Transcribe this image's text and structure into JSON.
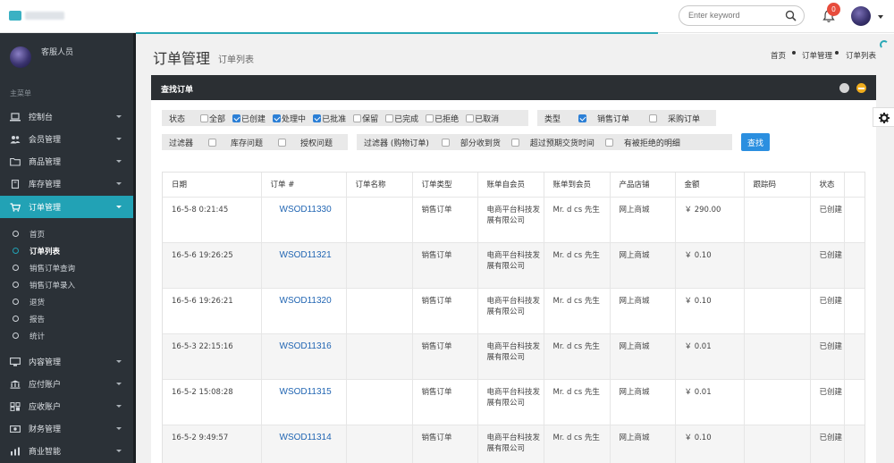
{
  "header": {
    "search_placeholder": "Enter keyword",
    "notification_count": "0"
  },
  "sidebar": {
    "user_name": "客服人员",
    "menu_heading": "主菜单",
    "items": [
      {
        "label": "控制台",
        "icon": "laptop-icon"
      },
      {
        "label": "会员管理",
        "icon": "users-icon"
      },
      {
        "label": "商品管理",
        "icon": "folder-icon"
      },
      {
        "label": "库存管理",
        "icon": "book-icon"
      },
      {
        "label": "订单管理",
        "icon": "cart-icon",
        "active": true
      }
    ],
    "sub_items": [
      {
        "label": "首页"
      },
      {
        "label": "订单列表",
        "current": true
      },
      {
        "label": "销售订单查询"
      },
      {
        "label": "销售订单录入"
      },
      {
        "label": "退货"
      },
      {
        "label": "报告"
      },
      {
        "label": "统计"
      }
    ],
    "items_after": [
      {
        "label": "内容管理",
        "icon": "desktop-icon"
      },
      {
        "label": "应付账户",
        "icon": "bank-icon"
      },
      {
        "label": "应收账户",
        "icon": "receivable-icon"
      },
      {
        "label": "财务管理",
        "icon": "money-icon"
      },
      {
        "label": "商业智能",
        "icon": "chart-icon"
      }
    ]
  },
  "page": {
    "title": "订单管理",
    "subtitle": "订单列表",
    "breadcrumb": [
      "首页",
      "订单管理",
      "订单列表"
    ]
  },
  "panel": {
    "title": "查找订单"
  },
  "filters": {
    "status_label": "状态",
    "status_options": [
      {
        "label": "全部",
        "checked": false
      },
      {
        "label": "已创建",
        "checked": true
      },
      {
        "label": "处理中",
        "checked": true
      },
      {
        "label": "已批准",
        "checked": true
      },
      {
        "label": "保留",
        "checked": false
      },
      {
        "label": "已完成",
        "checked": false
      },
      {
        "label": "已拒绝",
        "checked": false
      },
      {
        "label": "已取消",
        "checked": false
      }
    ],
    "type_label": "类型",
    "type_options": [
      {
        "label": "销售订单",
        "checked": true
      },
      {
        "label": "采购订单",
        "checked": false
      }
    ],
    "filter_label": "过滤器",
    "filter_options": [
      {
        "label": "库存问题",
        "checked": false
      },
      {
        "label": "授权问题",
        "checked": false
      }
    ],
    "cart_filter_label": "过滤器 (购物订单)",
    "cart_filter_options": [
      {
        "label": "部分收到货",
        "checked": false
      },
      {
        "label": "超过预期交货时间",
        "checked": false
      },
      {
        "label": "有被拒绝的明细",
        "checked": false
      }
    ],
    "search_button": "查找"
  },
  "table": {
    "columns": [
      "日期",
      "订单 #",
      "订单名称",
      "订单类型",
      "账单自会员",
      "账单到会员",
      "产品店铺",
      "金额",
      "跟踪码",
      "状态"
    ],
    "rows": [
      {
        "date": "16-5-8 0:21:45",
        "order": "WSOD11330",
        "name": "",
        "type": "销售订单",
        "from": "电商平台科技发展有限公司",
        "to": "Mr. d cs 先生",
        "store": "网上商城",
        "amount": "￥ 290.00",
        "tracking": "",
        "status": "已创建"
      },
      {
        "date": "16-5-6 19:26:25",
        "order": "WSOD11321",
        "name": "",
        "type": "销售订单",
        "from": "电商平台科技发展有限公司",
        "to": "Mr. d cs 先生",
        "store": "网上商城",
        "amount": "￥ 0.10",
        "tracking": "",
        "status": "已创建"
      },
      {
        "date": "16-5-6 19:26:21",
        "order": "WSOD11320",
        "name": "",
        "type": "销售订单",
        "from": "电商平台科技发展有限公司",
        "to": "Mr. d cs 先生",
        "store": "网上商城",
        "amount": "￥ 0.10",
        "tracking": "",
        "status": "已创建"
      },
      {
        "date": "16-5-3 22:15:16",
        "order": "WSOD11316",
        "name": "",
        "type": "销售订单",
        "from": "电商平台科技发展有限公司",
        "to": "Mr. d cs 先生",
        "store": "网上商城",
        "amount": "￥ 0.01",
        "tracking": "",
        "status": "已创建"
      },
      {
        "date": "16-5-2 15:08:28",
        "order": "WSOD11315",
        "name": "",
        "type": "销售订单",
        "from": "电商平台科技发展有限公司",
        "to": "Mr. d cs 先生",
        "store": "网上商城",
        "amount": "￥ 0.01",
        "tracking": "",
        "status": "已创建"
      },
      {
        "date": "16-5-2 9:49:57",
        "order": "WSOD11314",
        "name": "",
        "type": "销售订单",
        "from": "电商平台科技发展有限公司",
        "to": "Mr. d cs 先生",
        "store": "网上商城",
        "amount": "￥ 0.10",
        "tracking": "",
        "status": "已创建"
      }
    ]
  }
}
